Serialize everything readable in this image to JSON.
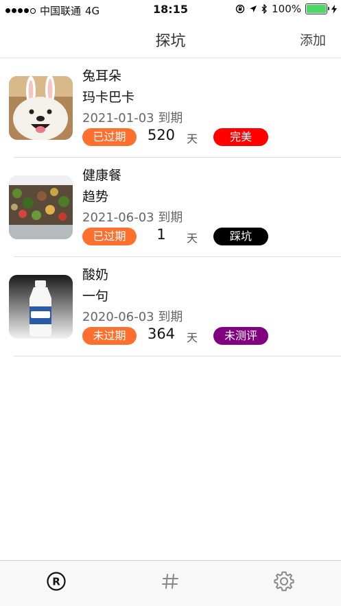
{
  "status_bar": {
    "carrier": "中国联通",
    "network": "4G",
    "time": "18:15",
    "battery": "100%"
  },
  "nav": {
    "title": "探坑",
    "add_label": "添加"
  },
  "items": [
    {
      "name": "兔耳朵",
      "brand": "玛卡巴卡",
      "date": "2021-01-03  到期",
      "status": "已过期",
      "days": "520",
      "unit": "天",
      "rating": "完美",
      "rating_color": "#ff0000"
    },
    {
      "name": "健康餐",
      "brand": "趋势",
      "date": "2021-06-03  到期",
      "status": "已过期",
      "days": "1",
      "unit": "天",
      "rating": "踩坑",
      "rating_color": "#000000"
    },
    {
      "name": "酸奶",
      "brand": "一句",
      "date": "2020-06-03  到期",
      "status": "未过期",
      "days": "364",
      "unit": "天",
      "rating": "未测评",
      "rating_color": "#800080"
    }
  ],
  "colors": {
    "status_badge": "#ff6f2e"
  },
  "tabbar": {
    "tabs": [
      {
        "icon": "registered-icon"
      },
      {
        "icon": "hashtag-icon"
      },
      {
        "icon": "gear-icon"
      }
    ]
  }
}
